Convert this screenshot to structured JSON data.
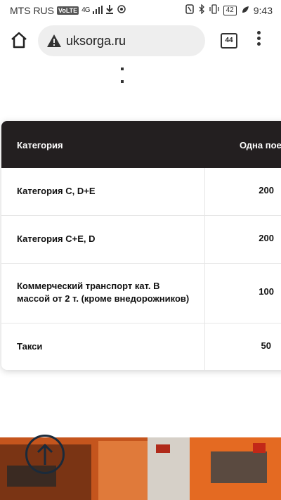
{
  "status_bar": {
    "carrier": "MTS RUS",
    "volte": "VoLTE",
    "network": "4G",
    "battery": "42",
    "time": "9:43"
  },
  "browser": {
    "url": "uksorga.ru",
    "tab_count": "44"
  },
  "table": {
    "headers": {
      "category": "Категория",
      "one_trip": "Одна поезд"
    },
    "rows": [
      {
        "category": "Категория С, D+E",
        "value": "200"
      },
      {
        "category": "Категория С+Е, D",
        "value": "200"
      },
      {
        "category": "Коммерческий транспорт кат. В массой от 2 т. (кроме внедорожников)",
        "value": "100"
      },
      {
        "category": "Такси",
        "value": "50"
      }
    ]
  },
  "colors": {
    "table_header_bg": "#231f20",
    "banner_accent": "#d9641f"
  }
}
